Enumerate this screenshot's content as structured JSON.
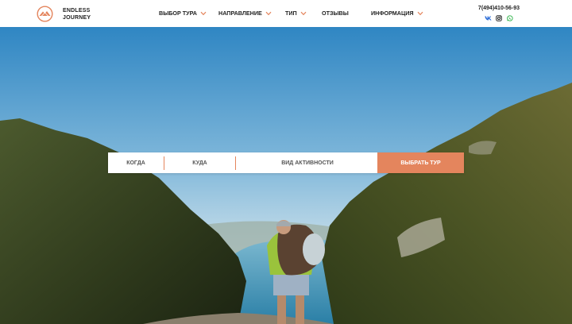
{
  "brand": {
    "line1": "ENDLESS",
    "line2": "JOURNEY"
  },
  "nav": {
    "tour_choice": "ВЫБОР ТУРА",
    "direction": "НАПРАВЛЕНИЕ",
    "type": "ТИП",
    "reviews": "ОТЗЫВЫ",
    "info": "ИНФОРМАЦИЯ"
  },
  "contacts": {
    "phone": "7(494)410-56-93"
  },
  "icons": {
    "logo": "mountain-circle-logo",
    "chevron": "chevron-down-icon",
    "social": [
      "vk-icon",
      "instagram-icon",
      "whatsapp-icon"
    ]
  },
  "search": {
    "when": "КОГДА",
    "where": "КУДА",
    "activity": "ВИД АКТИВНОСТИ",
    "submit": "ВЫБРАТЬ ТУР"
  },
  "colors": {
    "accent": "#e4855d",
    "text": "#222222",
    "vk": "#2f6fd8",
    "whatsapp": "#2fb34a"
  }
}
